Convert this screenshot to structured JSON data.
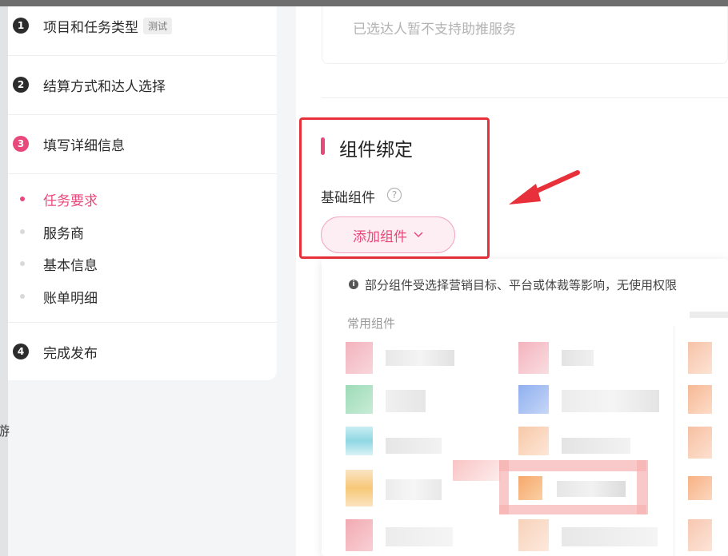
{
  "sidebar": {
    "steps": [
      {
        "num": "1",
        "label": "项目和任务类型",
        "tag": "测试"
      },
      {
        "num": "2",
        "label": "结算方式和达人选择"
      },
      {
        "num": "3",
        "label": "填写详细信息"
      },
      {
        "num": "4",
        "label": "完成发布"
      }
    ],
    "subitems": [
      {
        "label": "任务要求"
      },
      {
        "label": "服务商"
      },
      {
        "label": "基本信息"
      },
      {
        "label": "账单明细"
      }
    ],
    "edge_char": "游"
  },
  "main": {
    "notice": "已选达人暂不支持助推服务",
    "section_title": "组件绑定",
    "basic_label": "基础组件",
    "help_glyph": "?",
    "add_button": "添加组件",
    "dropdown": {
      "info": "部分组件受选择营销目标、平台或体裁等影响，无使用权限",
      "column_head": "常用组件"
    }
  },
  "colors": {
    "accent": "#e9487a",
    "highlight_box": "#e8303a",
    "annotation_arrow": "#e8303a"
  },
  "icons": [
    "help-icon",
    "chevron-down-icon",
    "info-icon",
    "annotation-arrow-icon"
  ]
}
